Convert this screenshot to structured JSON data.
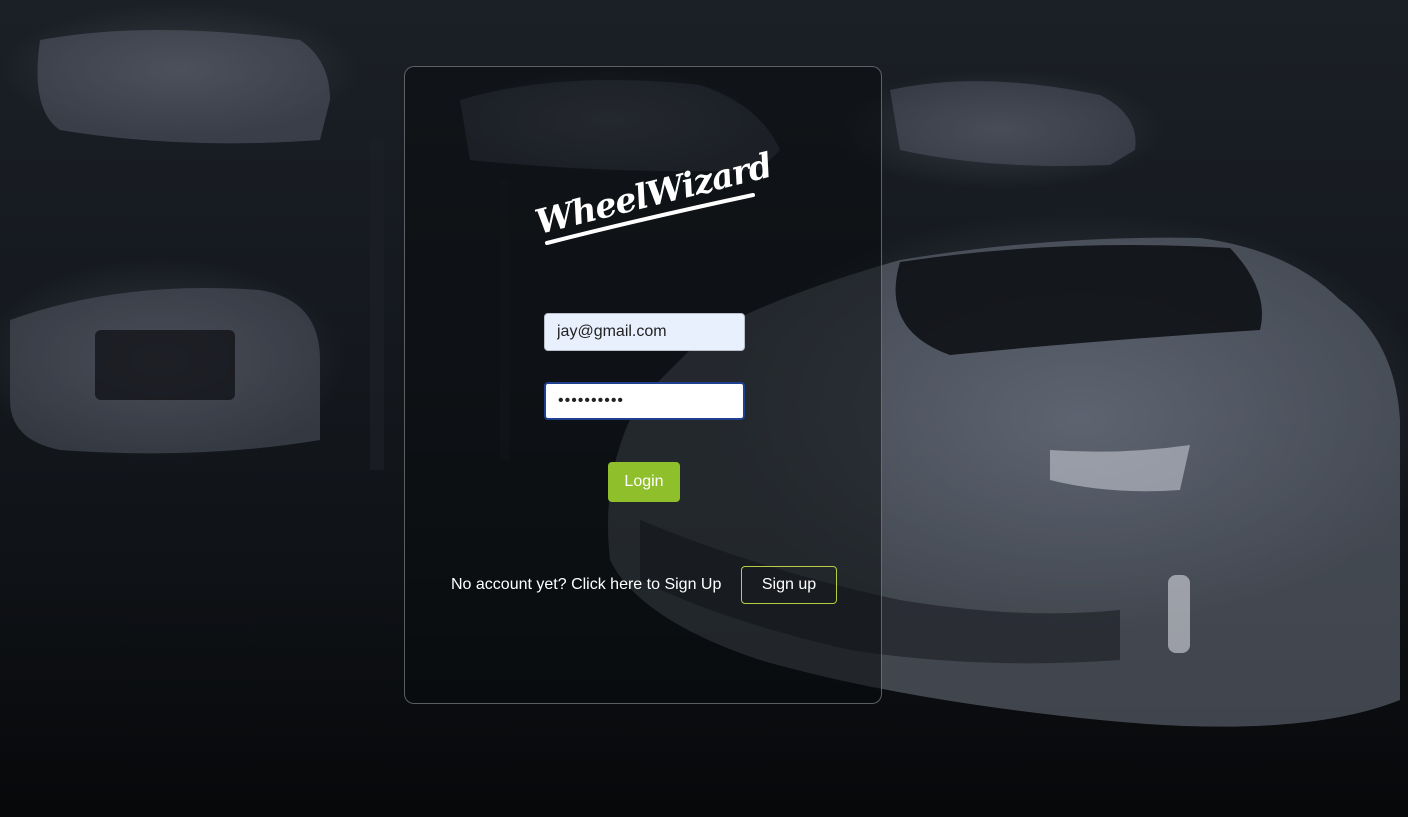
{
  "brand": {
    "logo_text": "WheelWizard"
  },
  "login_form": {
    "email_value": "jay@gmail.com",
    "password_value": "••••••••••",
    "login_label": "Login"
  },
  "signup": {
    "prompt_text": "No account yet? Click here to Sign Up",
    "button_label": "Sign up"
  },
  "colors": {
    "login_button": "#8fbf2b",
    "signup_border": "#b8cc45",
    "email_autofill_bg": "#e8f0fe",
    "password_focus_border": "#1f3f8f"
  }
}
